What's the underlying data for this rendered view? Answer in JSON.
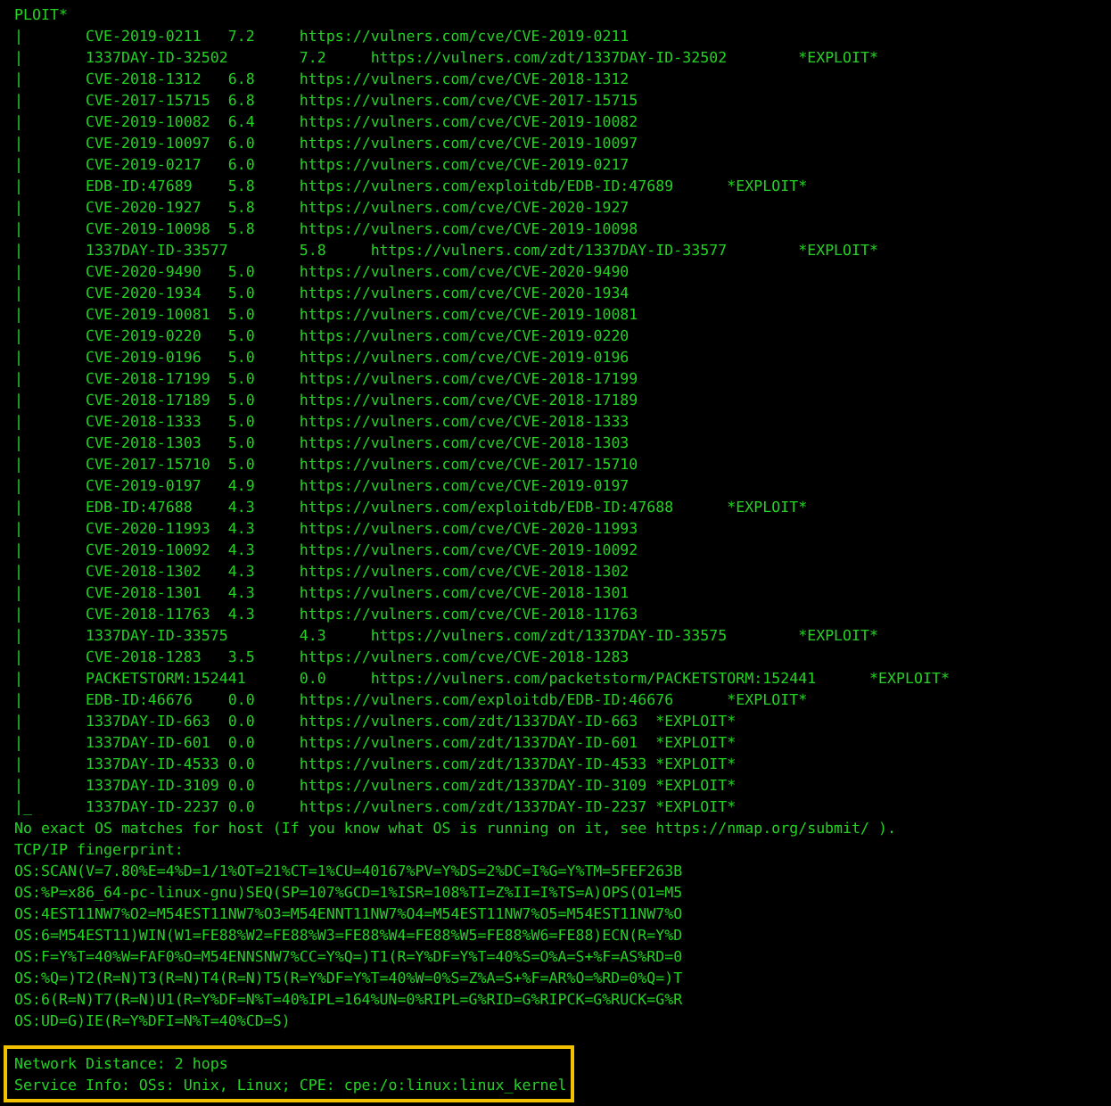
{
  "header_line": "PLOIT*",
  "vulns": [
    {
      "prefix": "|",
      "id": "CVE-2019-0211",
      "score": "7.2",
      "url": "https://vulners.com/cve/CVE-2019-0211"
    },
    {
      "prefix": "|",
      "id": "1337DAY-ID-32502",
      "score": "7.2",
      "url": "https://vulners.com/zdt/1337DAY-ID-32502",
      "tag": "*EXPLOIT*"
    },
    {
      "prefix": "|",
      "id": "CVE-2018-1312",
      "score": "6.8",
      "url": "https://vulners.com/cve/CVE-2018-1312"
    },
    {
      "prefix": "|",
      "id": "CVE-2017-15715",
      "score": "6.8",
      "url": "https://vulners.com/cve/CVE-2017-15715"
    },
    {
      "prefix": "|",
      "id": "CVE-2019-10082",
      "score": "6.4",
      "url": "https://vulners.com/cve/CVE-2019-10082"
    },
    {
      "prefix": "|",
      "id": "CVE-2019-10097",
      "score": "6.0",
      "url": "https://vulners.com/cve/CVE-2019-10097"
    },
    {
      "prefix": "|",
      "id": "CVE-2019-0217",
      "score": "6.0",
      "url": "https://vulners.com/cve/CVE-2019-0217"
    },
    {
      "prefix": "|",
      "id": "EDB-ID:47689",
      "score": "5.8",
      "url": "https://vulners.com/exploitdb/EDB-ID:47689",
      "tag": "*EXPLOIT*"
    },
    {
      "prefix": "|",
      "id": "CVE-2020-1927",
      "score": "5.8",
      "url": "https://vulners.com/cve/CVE-2020-1927"
    },
    {
      "prefix": "|",
      "id": "CVE-2019-10098",
      "score": "5.8",
      "url": "https://vulners.com/cve/CVE-2019-10098"
    },
    {
      "prefix": "|",
      "id": "1337DAY-ID-33577",
      "score": "5.8",
      "url": "https://vulners.com/zdt/1337DAY-ID-33577",
      "tag": "*EXPLOIT*"
    },
    {
      "prefix": "|",
      "id": "CVE-2020-9490",
      "score": "5.0",
      "url": "https://vulners.com/cve/CVE-2020-9490"
    },
    {
      "prefix": "|",
      "id": "CVE-2020-1934",
      "score": "5.0",
      "url": "https://vulners.com/cve/CVE-2020-1934"
    },
    {
      "prefix": "|",
      "id": "CVE-2019-10081",
      "score": "5.0",
      "url": "https://vulners.com/cve/CVE-2019-10081"
    },
    {
      "prefix": "|",
      "id": "CVE-2019-0220",
      "score": "5.0",
      "url": "https://vulners.com/cve/CVE-2019-0220"
    },
    {
      "prefix": "|",
      "id": "CVE-2019-0196",
      "score": "5.0",
      "url": "https://vulners.com/cve/CVE-2019-0196"
    },
    {
      "prefix": "|",
      "id": "CVE-2018-17199",
      "score": "5.0",
      "url": "https://vulners.com/cve/CVE-2018-17199"
    },
    {
      "prefix": "|",
      "id": "CVE-2018-17189",
      "score": "5.0",
      "url": "https://vulners.com/cve/CVE-2018-17189"
    },
    {
      "prefix": "|",
      "id": "CVE-2018-1333",
      "score": "5.0",
      "url": "https://vulners.com/cve/CVE-2018-1333"
    },
    {
      "prefix": "|",
      "id": "CVE-2018-1303",
      "score": "5.0",
      "url": "https://vulners.com/cve/CVE-2018-1303"
    },
    {
      "prefix": "|",
      "id": "CVE-2017-15710",
      "score": "5.0",
      "url": "https://vulners.com/cve/CVE-2017-15710"
    },
    {
      "prefix": "|",
      "id": "CVE-2019-0197",
      "score": "4.9",
      "url": "https://vulners.com/cve/CVE-2019-0197"
    },
    {
      "prefix": "|",
      "id": "EDB-ID:47688",
      "score": "4.3",
      "url": "https://vulners.com/exploitdb/EDB-ID:47688",
      "tag": "*EXPLOIT*"
    },
    {
      "prefix": "|",
      "id": "CVE-2020-11993",
      "score": "4.3",
      "url": "https://vulners.com/cve/CVE-2020-11993"
    },
    {
      "prefix": "|",
      "id": "CVE-2019-10092",
      "score": "4.3",
      "url": "https://vulners.com/cve/CVE-2019-10092"
    },
    {
      "prefix": "|",
      "id": "CVE-2018-1302",
      "score": "4.3",
      "url": "https://vulners.com/cve/CVE-2018-1302"
    },
    {
      "prefix": "|",
      "id": "CVE-2018-1301",
      "score": "4.3",
      "url": "https://vulners.com/cve/CVE-2018-1301"
    },
    {
      "prefix": "|",
      "id": "CVE-2018-11763",
      "score": "4.3",
      "url": "https://vulners.com/cve/CVE-2018-11763"
    },
    {
      "prefix": "|",
      "id": "1337DAY-ID-33575",
      "score": "4.3",
      "url": "https://vulners.com/zdt/1337DAY-ID-33575",
      "tag": "*EXPLOIT*"
    },
    {
      "prefix": "|",
      "id": "CVE-2018-1283",
      "score": "3.5",
      "url": "https://vulners.com/cve/CVE-2018-1283"
    },
    {
      "prefix": "|",
      "id": "PACKETSTORM:152441",
      "score": "0.0",
      "url": "https://vulners.com/packetstorm/PACKETSTORM:152441",
      "tag": "*EXPLOIT*"
    },
    {
      "prefix": "|",
      "id": "EDB-ID:46676",
      "score": "0.0",
      "url": "https://vulners.com/exploitdb/EDB-ID:46676",
      "tag": "*EXPLOIT*"
    },
    {
      "prefix": "|",
      "id": "1337DAY-ID-663",
      "score": "0.0",
      "url": "https://vulners.com/zdt/1337DAY-ID-663",
      "tag": "*EXPLOIT*"
    },
    {
      "prefix": "|",
      "id": "1337DAY-ID-601",
      "score": "0.0",
      "url": "https://vulners.com/zdt/1337DAY-ID-601",
      "tag": "*EXPLOIT*"
    },
    {
      "prefix": "|",
      "id": "1337DAY-ID-4533",
      "score": "0.0",
      "url": "https://vulners.com/zdt/1337DAY-ID-4533",
      "tag": "*EXPLOIT*"
    },
    {
      "prefix": "|",
      "id": "1337DAY-ID-3109",
      "score": "0.0",
      "url": "https://vulners.com/zdt/1337DAY-ID-3109",
      "tag": "*EXPLOIT*"
    },
    {
      "prefix": "|_",
      "id": "1337DAY-ID-2237",
      "score": "0.0",
      "url": "https://vulners.com/zdt/1337DAY-ID-2237",
      "tag": "*EXPLOIT*"
    }
  ],
  "os_note": "No exact OS matches for host (If you know what OS is running on it, see https://nmap.org/submit/ ).",
  "fingerprint_title": "TCP/IP fingerprint:",
  "fingerprint_lines": [
    "OS:SCAN(V=7.80%E=4%D=1/1%OT=21%CT=1%CU=40167%PV=Y%DS=2%DC=I%G=Y%TM=5FEF263B",
    "OS:%P=x86_64-pc-linux-gnu)SEQ(SP=107%GCD=1%ISR=108%TI=Z%II=I%TS=A)OPS(O1=M5",
    "OS:4EST11NW7%O2=M54EST11NW7%O3=M54ENNT11NW7%O4=M54EST11NW7%O5=M54EST11NW7%O",
    "OS:6=M54EST11)WIN(W1=FE88%W2=FE88%W3=FE88%W4=FE88%W5=FE88%W6=FE88)ECN(R=Y%D",
    "OS:F=Y%T=40%W=FAF0%O=M54ENNSNW7%CC=Y%Q=)T1(R=Y%DF=Y%T=40%S=O%A=S+%F=AS%RD=0",
    "OS:%Q=)T2(R=N)T3(R=N)T4(R=N)T5(R=Y%DF=Y%T=40%W=0%S=Z%A=S+%F=AR%O=%RD=0%Q=)T",
    "OS:6(R=N)T7(R=N)U1(R=Y%DF=N%T=40%IPL=164%UN=0%RIPL=G%RID=G%RIPCK=G%RUCK=G%R",
    "OS:UD=G)IE(R=Y%DFI=N%T=40%CD=S)"
  ],
  "highlighted": [
    "Network Distance: 2 hops",
    "Service Info: OSs: Unix, Linux; CPE: cpe:/o:linux:linux_kernel"
  ]
}
